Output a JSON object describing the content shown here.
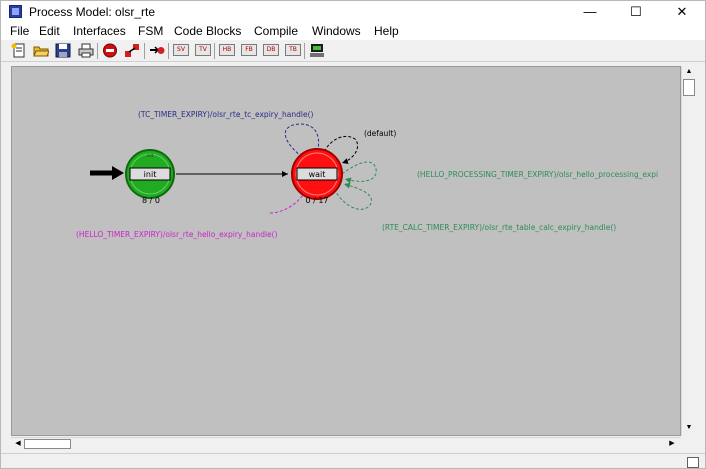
{
  "window": {
    "title": "Process Model: olsr_rte",
    "controls": {
      "minimize": "—",
      "maximize": "☐",
      "close": "✕"
    }
  },
  "menu": [
    "File",
    "Edit",
    "Interfaces",
    "FSM",
    "Code Blocks",
    "Compile",
    "Windows",
    "Help"
  ],
  "toolbar": {
    "icons": [
      "new-document-icon",
      "open-folder-icon",
      "save-icon",
      "print-icon",
      "stop-icon",
      "transition-icon",
      "cut-state-icon"
    ],
    "text_buttons": [
      "SV",
      "TV",
      "HB",
      "FB",
      "DB",
      "TB"
    ],
    "last_icon": "compile-icon"
  },
  "fsm": {
    "states": [
      {
        "id": "init",
        "label": "init",
        "sub": "init",
        "counts": "8 / 0",
        "fill": "#22aa22"
      },
      {
        "id": "wait",
        "label": "wait",
        "sub": "",
        "counts": "0 / 17",
        "fill": "#ff1010"
      }
    ],
    "transitions": {
      "tc_timer": {
        "label": "(TC_TIMER_EXPIRY)/olsr_rte_tc_expiry_handle()",
        "color": "#2a2a8a"
      },
      "default": {
        "label": "(default)",
        "color": "#000000"
      },
      "hello_processing": {
        "label": "(HELLO_PROCESSING_TIMER_EXPIRY)/olsr_hello_processing_expi",
        "color": "#2e8b57"
      },
      "rte_calc": {
        "label": "(RTE_CALC_TIMER_EXPIRY)/olsr_rte_table_calc_expiry_handle()",
        "color": "#2e8b57"
      },
      "hello_timer": {
        "label": "(HELLO_TIMER_EXPIRY)/olsr_rte_hello_expiry_handle()",
        "color": "#cc22cc"
      }
    }
  }
}
